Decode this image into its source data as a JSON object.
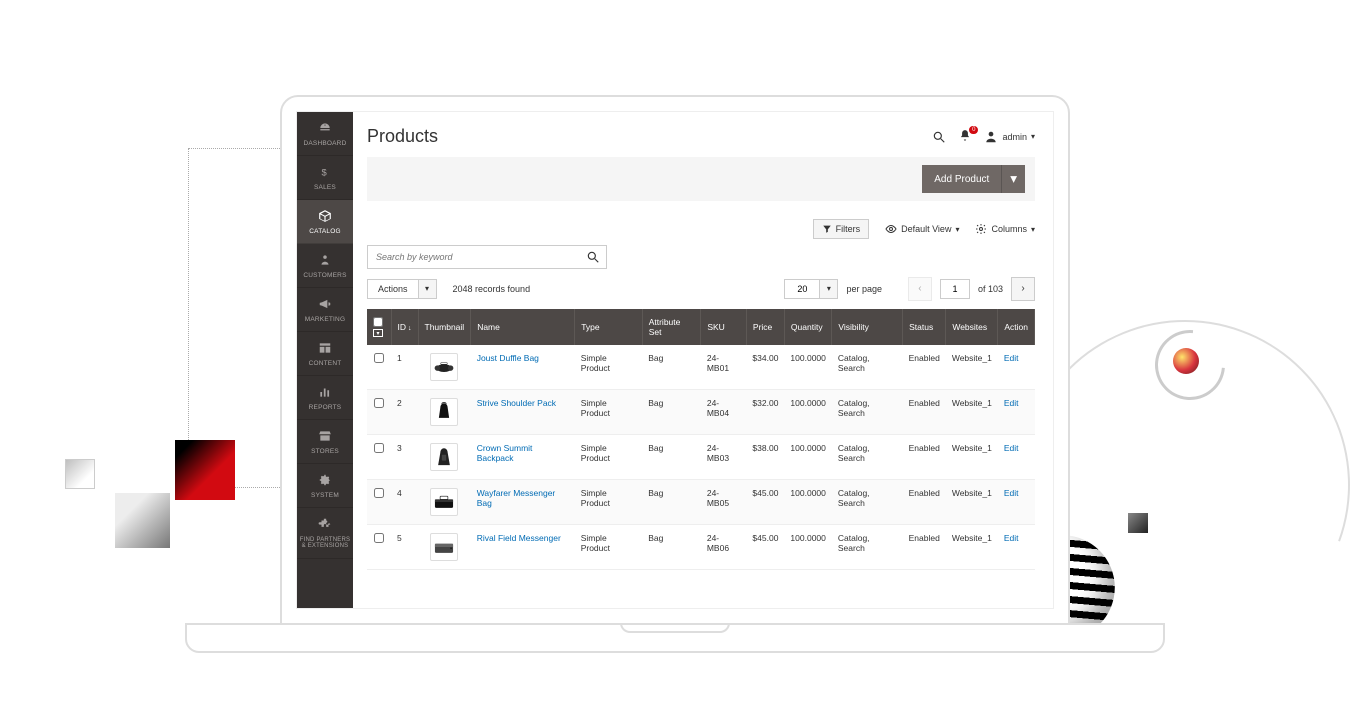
{
  "header": {
    "page_title": "Products",
    "notif_count": "0",
    "user_label": "admin"
  },
  "sidebar": {
    "items": [
      {
        "key": "dashboard",
        "label": "DASHBOARD"
      },
      {
        "key": "sales",
        "label": "SALES"
      },
      {
        "key": "catalog",
        "label": "CATALOG"
      },
      {
        "key": "customers",
        "label": "CUSTOMERS"
      },
      {
        "key": "marketing",
        "label": "MARKETING"
      },
      {
        "key": "content",
        "label": "CONTENT"
      },
      {
        "key": "reports",
        "label": "REPORTS"
      },
      {
        "key": "stores",
        "label": "STORES"
      },
      {
        "key": "system",
        "label": "SYSTEM"
      },
      {
        "key": "partners",
        "label": "FIND PARTNERS & EXTENSIONS"
      }
    ]
  },
  "action_bar": {
    "add_product_label": "Add Product"
  },
  "toolbar": {
    "filters_label": "Filters",
    "default_view_label": "Default View",
    "columns_label": "Columns"
  },
  "search": {
    "placeholder": "Search by keyword"
  },
  "grid_controls": {
    "actions_label": "Actions",
    "records_found": "2048 records found",
    "per_page_value": "20",
    "per_page_label": "per page",
    "current_page": "1",
    "total_pages_label": "of 103"
  },
  "columns": {
    "id": "ID",
    "thumbnail": "Thumbnail",
    "name": "Name",
    "type": "Type",
    "attribute_set": "Attribute Set",
    "sku": "SKU",
    "price": "Price",
    "quantity": "Quantity",
    "visibility": "Visibility",
    "status": "Status",
    "websites": "Websites",
    "action": "Action"
  },
  "rows": [
    {
      "id": "1",
      "name": "Joust Duffle Bag",
      "type": "Simple Product",
      "attr": "Bag",
      "sku": "24-MB01",
      "price": "$34.00",
      "qty": "100.0000",
      "visibility": "Catalog, Search",
      "status": "Enabled",
      "websites": "Website_1",
      "action": "Edit"
    },
    {
      "id": "2",
      "name": "Strive Shoulder Pack",
      "type": "Simple Product",
      "attr": "Bag",
      "sku": "24-MB04",
      "price": "$32.00",
      "qty": "100.0000",
      "visibility": "Catalog, Search",
      "status": "Enabled",
      "websites": "Website_1",
      "action": "Edit"
    },
    {
      "id": "3",
      "name": "Crown Summit Backpack",
      "type": "Simple Product",
      "attr": "Bag",
      "sku": "24-MB03",
      "price": "$38.00",
      "qty": "100.0000",
      "visibility": "Catalog, Search",
      "status": "Enabled",
      "websites": "Website_1",
      "action": "Edit"
    },
    {
      "id": "4",
      "name": "Wayfarer Messenger Bag",
      "type": "Simple Product",
      "attr": "Bag",
      "sku": "24-MB05",
      "price": "$45.00",
      "qty": "100.0000",
      "visibility": "Catalog, Search",
      "status": "Enabled",
      "websites": "Website_1",
      "action": "Edit"
    },
    {
      "id": "5",
      "name": "Rival Field Messenger",
      "type": "Simple Product",
      "attr": "Bag",
      "sku": "24-MB06",
      "price": "$45.00",
      "qty": "100.0000",
      "visibility": "Catalog, Search",
      "status": "Enabled",
      "websites": "Website_1",
      "action": "Edit"
    }
  ]
}
